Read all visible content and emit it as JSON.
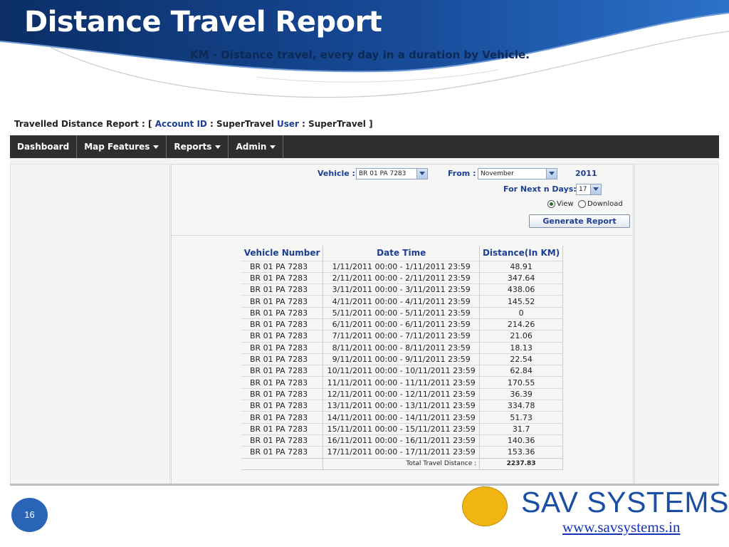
{
  "slide": {
    "title": "Distance Travel Report",
    "subtitle": "KM - Distance travel, every day in a duration by Vehicle.",
    "page_number": "16"
  },
  "app": {
    "titlebar": {
      "prefix": "Travelled Distance Report : [ ",
      "account_label": "Account ID",
      "account_value": " : SuperTravel ",
      "user_label": "User",
      "user_value": " : SuperTravel ]"
    },
    "menu": {
      "items": [
        {
          "label": "Dashboard",
          "dropdown": false
        },
        {
          "label": "Map Features",
          "dropdown": true
        },
        {
          "label": "Reports",
          "dropdown": true
        },
        {
          "label": "Admin",
          "dropdown": true
        }
      ]
    },
    "filters": {
      "vehicle_label": "Vehicle :",
      "vehicle_value": "BR 01 PA 7283",
      "from_label": "From :",
      "from_value": "November",
      "year": "2011",
      "next_days_label": "For Next n Days:",
      "next_days_value": "17",
      "option_view": "View",
      "option_download": "Download",
      "selected_option": "View",
      "generate_label": "Generate Report"
    },
    "table": {
      "headers": [
        "Vehicle Number",
        "Date Time",
        "Distance(In KM)"
      ],
      "rows": [
        [
          "BR 01 PA 7283",
          "1/11/2011 00:00 - 1/11/2011 23:59",
          "48.91"
        ],
        [
          "BR 01 PA 7283",
          "2/11/2011 00:00 - 2/11/2011 23:59",
          "347.64"
        ],
        [
          "BR 01 PA 7283",
          "3/11/2011 00:00 - 3/11/2011 23:59",
          "438.06"
        ],
        [
          "BR 01 PA 7283",
          "4/11/2011 00:00 - 4/11/2011 23:59",
          "145.52"
        ],
        [
          "BR 01 PA 7283",
          "5/11/2011 00:00 - 5/11/2011 23:59",
          "0"
        ],
        [
          "BR 01 PA 7283",
          "6/11/2011 00:00 - 6/11/2011 23:59",
          "214.26"
        ],
        [
          "BR 01 PA 7283",
          "7/11/2011 00:00 - 7/11/2011 23:59",
          "21.06"
        ],
        [
          "BR 01 PA 7283",
          "8/11/2011 00:00 - 8/11/2011 23:59",
          "18.13"
        ],
        [
          "BR 01 PA 7283",
          "9/11/2011 00:00 - 9/11/2011 23:59",
          "22.54"
        ],
        [
          "BR 01 PA 7283",
          "10/11/2011 00:00 - 10/11/2011 23:59",
          "62.84"
        ],
        [
          "BR 01 PA 7283",
          "11/11/2011 00:00 - 11/11/2011 23:59",
          "170.55"
        ],
        [
          "BR 01 PA 7283",
          "12/11/2011 00:00 - 12/11/2011 23:59",
          "36.39"
        ],
        [
          "BR 01 PA 7283",
          "13/11/2011 00:00 - 13/11/2011 23:59",
          "334.78"
        ],
        [
          "BR 01 PA 7283",
          "14/11/2011 00:00 - 14/11/2011 23:59",
          "51.73"
        ],
        [
          "BR 01 PA 7283",
          "15/11/2011 00:00 - 15/11/2011 23:59",
          "31.7"
        ],
        [
          "BR 01 PA 7283",
          "16/11/2011 00:00 - 16/11/2011 23:59",
          "140.36"
        ],
        [
          "BR 01 PA 7283",
          "17/11/2011 00:00 - 17/11/2011 23:59",
          "153.36"
        ]
      ],
      "total_label": "Total Travel Distance :",
      "total_value": "2237.83"
    }
  },
  "footer": {
    "brand": "SAV SYSTEMS",
    "url": "www.savsystems.in"
  },
  "colors": {
    "header_dark": "#0b2e66",
    "header_mid": "#1f5eb5",
    "menu_bg": "#2e2e2e",
    "link_blue": "#1c3f94",
    "brand_blue": "#1a4fa3",
    "logo_yellow": "#f0b513",
    "badge_blue": "#2a64b7"
  }
}
